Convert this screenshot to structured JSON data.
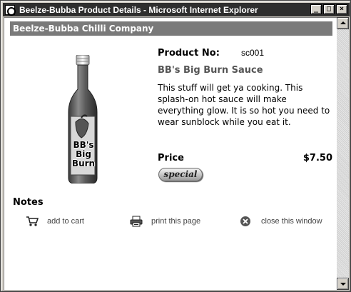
{
  "window": {
    "title": "Beelze-Bubba Product Details - Microsoft Internet Explorer",
    "buttons": {
      "minimize": "_",
      "maximize": "□",
      "close": "×"
    }
  },
  "header": {
    "company_name": "Beelze-Bubba Chilli Company"
  },
  "product": {
    "number_label": "Product No:",
    "number": "sc001",
    "name": "BB's Big Burn Sauce",
    "description": "This stuff will get ya cooking. This splash-on hot sauce will make everything glow. It is so hot you need to wear sunblock while you eat it.",
    "price_label": "Price",
    "price": "$7.50",
    "badge": "special",
    "bottle_label_lines": [
      "BB's",
      "Big",
      "Burn"
    ]
  },
  "notes": {
    "heading": "Notes"
  },
  "actions": [
    {
      "label": "add to cart",
      "icon": "cart-icon"
    },
    {
      "label": "print this page",
      "icon": "printer-icon"
    },
    {
      "label": "close this window",
      "icon": "close-circle-icon"
    }
  ],
  "colors": {
    "title_bar": "#2e2e2e",
    "company_bar": "#7a7a7a",
    "product_name": "#555555"
  }
}
